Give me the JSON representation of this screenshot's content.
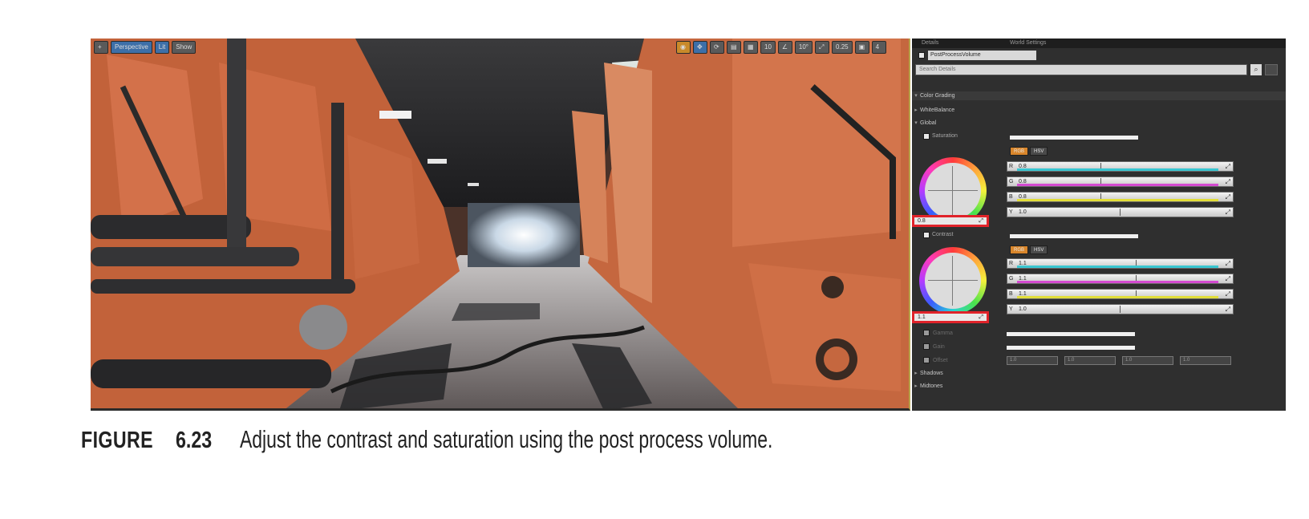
{
  "viewport": {
    "left_buttons": [
      "+",
      "Perspective",
      "Lit",
      "Show"
    ],
    "right_buttons": [
      "◉",
      "✥",
      "⟳",
      "▤",
      "▦",
      "10",
      "∠",
      "10°",
      "⤢",
      "0.25",
      "▣",
      "4"
    ]
  },
  "details_panel": {
    "tabs": [
      "Details",
      "World Settings"
    ],
    "object_name": "PostProcessVolume",
    "search_placeholder": "Search Details",
    "sections": {
      "color_grading": "Color Grading",
      "white_balance": "WhiteBalance",
      "global": "Global",
      "saturation": "Saturation",
      "contrast": "Contrast",
      "gamma": "Gamma",
      "gain": "Gain",
      "offset": "Offset",
      "shadows": "Shadows",
      "midtones": "Midtones"
    },
    "mode_buttons": [
      "RGB",
      "HSV"
    ],
    "saturation": {
      "wheel_value": "0.8",
      "sliders": [
        {
          "label": "R",
          "value": "0.8"
        },
        {
          "label": "G",
          "value": "0.8"
        },
        {
          "label": "B",
          "value": "0.8"
        },
        {
          "label": "Y",
          "value": "1.0"
        }
      ]
    },
    "contrast": {
      "wheel_value": "1.1",
      "sliders": [
        {
          "label": "R",
          "value": "1.1"
        },
        {
          "label": "G",
          "value": "1.1"
        },
        {
          "label": "B",
          "value": "1.1"
        },
        {
          "label": "Y",
          "value": "1.0"
        }
      ]
    },
    "gamma_fields": [
      "1.0",
      "1.0",
      "1.0",
      "1.0"
    ],
    "colors": {
      "highlight_box": "#e0232a",
      "active_mode": "#d9862b"
    }
  },
  "caption": {
    "label": "FIGURE",
    "number": "6.23",
    "text": "Adjust the contrast and saturation using the post process volume."
  }
}
